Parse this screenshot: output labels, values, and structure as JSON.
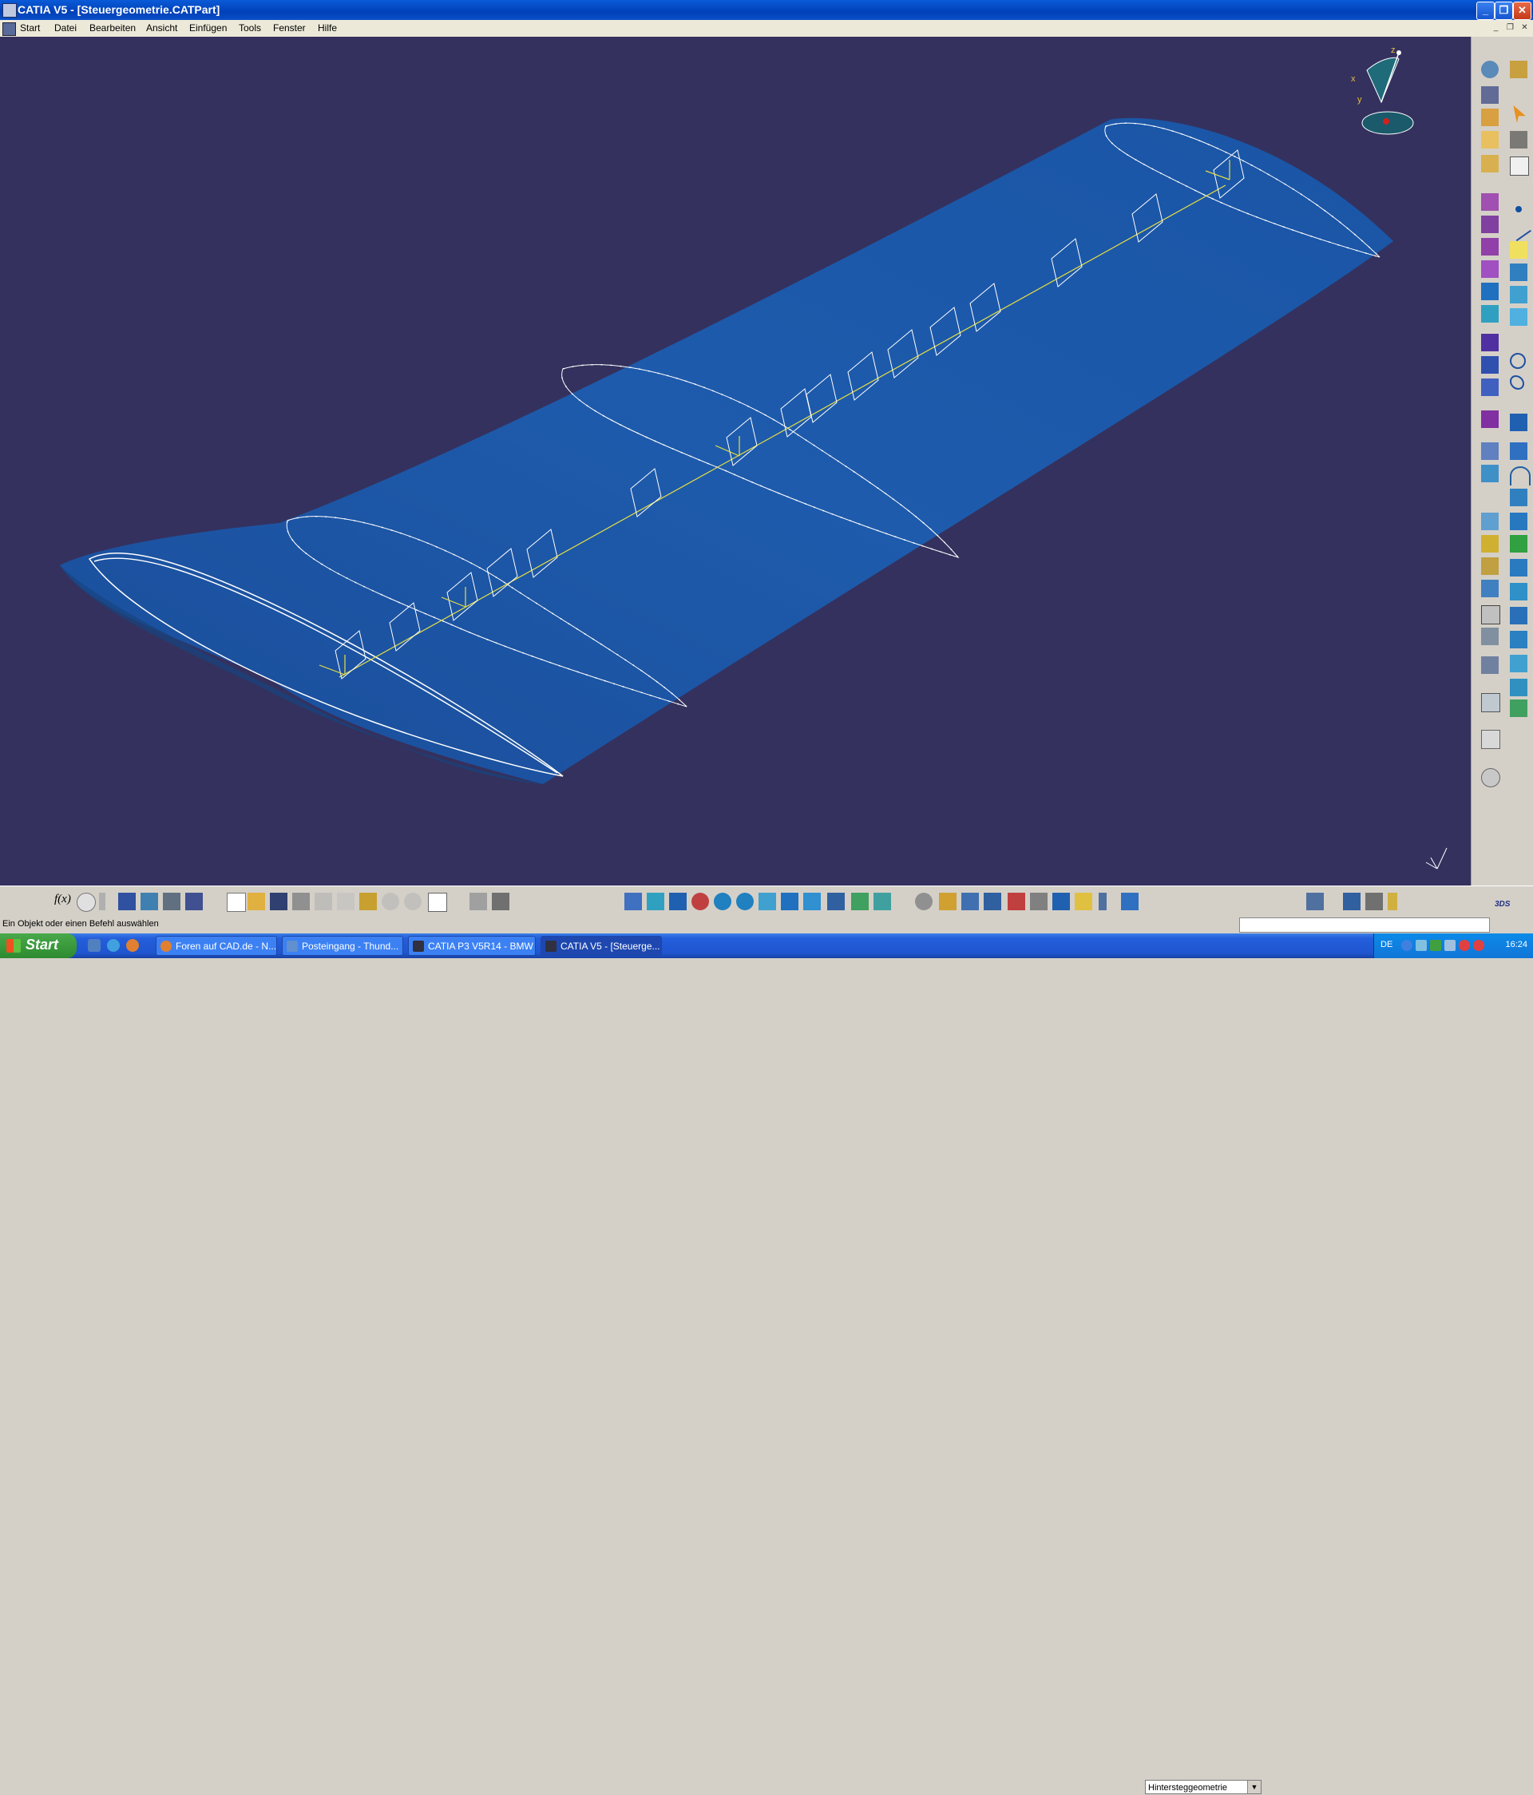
{
  "window": {
    "title": "CATIA V5 - [Steuergeometrie.CATPart]"
  },
  "menu": {
    "items": [
      {
        "label": "Start"
      },
      {
        "label": "Datei"
      },
      {
        "label": "Bearbeiten"
      },
      {
        "label": "Ansicht"
      },
      {
        "label": "Einfügen"
      },
      {
        "label": "Tools"
      },
      {
        "label": "Fenster"
      },
      {
        "label": "Hilfe"
      }
    ]
  },
  "compass": {
    "axis_x": "x",
    "axis_y": "y",
    "axis_z": "z"
  },
  "toolbar": {
    "formula_label": "f(x)",
    "current_geometrical_set": "Hintersteggeometrie"
  },
  "status": {
    "message": "Ein Objekt oder einen Befehl auswählen",
    "command_input": ""
  },
  "taskbar": {
    "start_label": "Start",
    "tasks": [
      {
        "label": "Foren auf CAD.de - N..."
      },
      {
        "label": "Posteingang - Thund..."
      },
      {
        "label": "CATIA P3 V5R14 - BMW"
      },
      {
        "label": "CATIA V5 - [Steuerge..."
      }
    ],
    "language": "DE",
    "clock": "16:24"
  },
  "colors": {
    "viewport_background": "#34315e",
    "wing_surface": "#1c5aa8",
    "curve_white": "#ffffff",
    "axis_yellow": "#e8e040"
  }
}
